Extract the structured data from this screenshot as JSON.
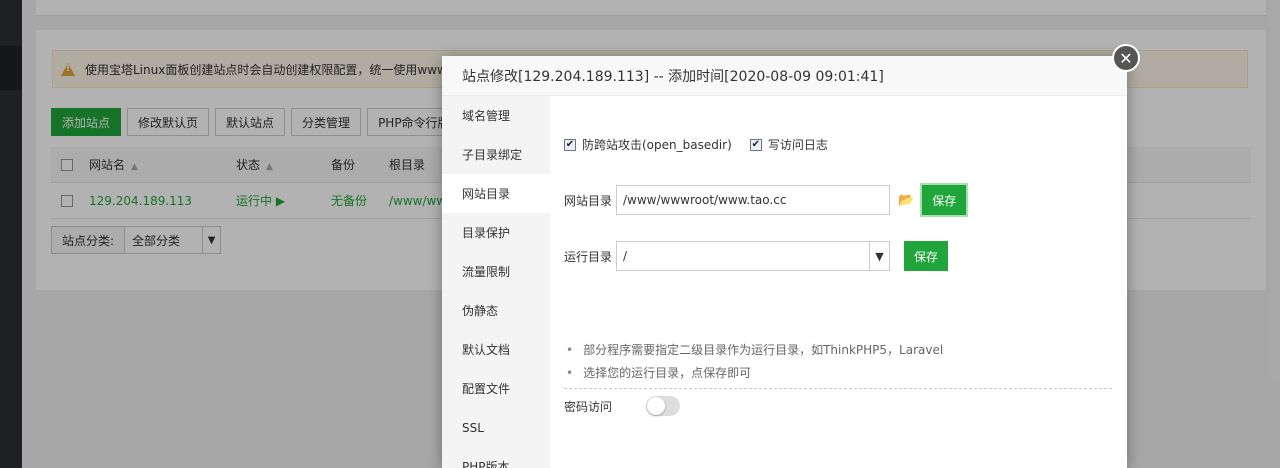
{
  "background": {
    "notice": "使用宝塔Linux面板创建站点时会自动创建权限配置，统一使用www用",
    "toolbar": [
      "添加站点",
      "修改默认页",
      "默认站点",
      "分类管理",
      "PHP命令行版本"
    ],
    "table": {
      "headers": {
        "name": "网站名",
        "status": "状态",
        "backup": "备份",
        "root": "根目录"
      },
      "row": {
        "name": "129.204.189.113",
        "status": "运行中 ▶",
        "backup": "无备份",
        "root": "/www/ww"
      }
    },
    "category": {
      "label": "站点分类:",
      "value": "全部分类"
    }
  },
  "dialog": {
    "title": "站点修改[129.204.189.113] -- 添加时间[2020-08-09 09:01:41]",
    "close": "✕",
    "menu": [
      "域名管理",
      "子目录绑定",
      "网站目录",
      "目录保护",
      "流量限制",
      "伪静态",
      "默认文档",
      "配置文件",
      "SSL",
      "PHP版本"
    ],
    "active_menu": "网站目录",
    "checkboxes": [
      {
        "label": "防跨站攻击(open_basedir)",
        "checked": true
      },
      {
        "label": "写访问日志",
        "checked": true
      }
    ],
    "site_dir": {
      "label": "网站目录",
      "value": "/www/wwwroot/www.tao.cc",
      "save": "保存"
    },
    "run_dir": {
      "label": "运行目录",
      "value": "/",
      "save": "保存"
    },
    "tips": [
      "部分程序需要指定二级目录作为运行目录，如ThinkPHP5，Laravel",
      "选择您的运行目录，点保存即可"
    ],
    "password_access": {
      "label": "密码访问",
      "enabled": false
    }
  }
}
